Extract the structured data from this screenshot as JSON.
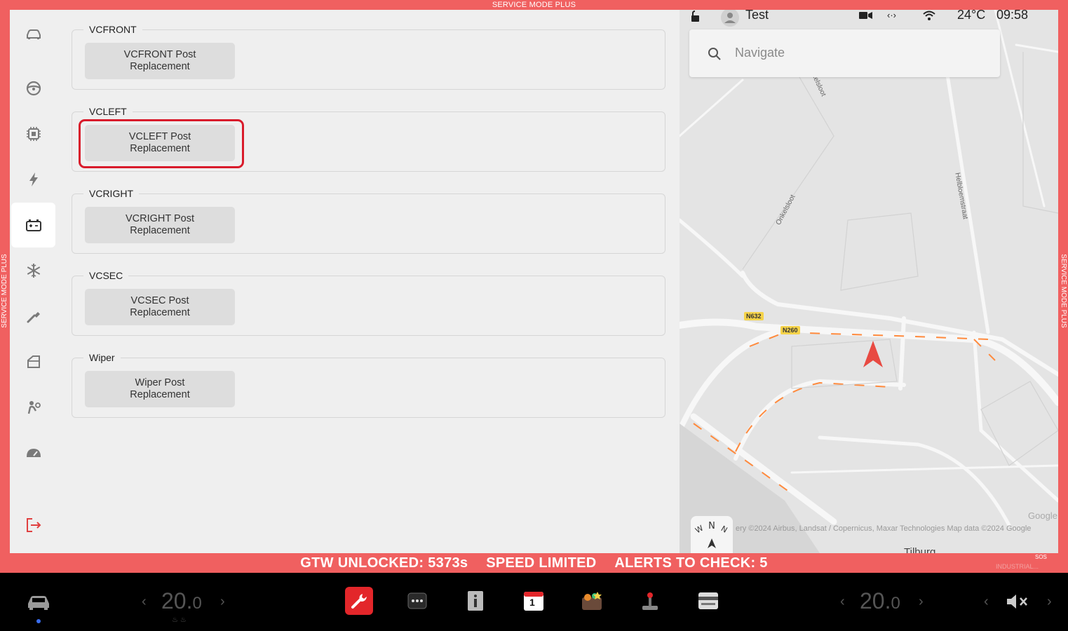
{
  "banner": {
    "top": "SERVICE MODE PLUS",
    "left": "SERVICE MODE PLUS",
    "right": "SERVICE MODE PLUS"
  },
  "sidebar": {
    "items": [
      {
        "icon": "car-icon"
      },
      {
        "icon": "steering-wheel-icon"
      },
      {
        "icon": "chip-icon"
      },
      {
        "icon": "lightning-icon"
      },
      {
        "icon": "battery-icon",
        "active": true
      },
      {
        "icon": "snowflake-icon"
      },
      {
        "icon": "wrench-tool-icon"
      },
      {
        "icon": "door-icon"
      },
      {
        "icon": "airbag-icon"
      },
      {
        "icon": "gauge-icon"
      },
      {
        "icon": "exit-icon"
      }
    ]
  },
  "sections": [
    {
      "label": "VCFRONT",
      "button": "VCFRONT Post\nReplacement"
    },
    {
      "label": "VCLEFT",
      "button": "VCLEFT Post\nReplacement"
    },
    {
      "label": "VCRIGHT",
      "button": "VCRIGHT Post\nReplacement"
    },
    {
      "label": "VCSEC",
      "button": "VCSEC Post\nReplacement"
    },
    {
      "label": "Wiper",
      "button": "Wiper Post\nReplacement"
    }
  ],
  "status": {
    "user": "Test",
    "temperature": "24°C",
    "time": "09:58"
  },
  "map": {
    "search_placeholder": "Navigate",
    "roads": {
      "n632": "N632",
      "n260": "N260",
      "onkelsloot_1": "Onkelsloot",
      "onkelsloot_2": "Onkelsloot",
      "helbloemstraat": "Helbloemstraat"
    },
    "attribution": "ery ©2024 Airbus, Landsat / Copernicus, Maxar Technologies Map data ©2024 Google",
    "google": "Google",
    "city": "Tilburg"
  },
  "alerts": {
    "gtw": "GTW UNLOCKED: 5373s",
    "speed": "SPEED LIMITED",
    "alerts": "ALERTS TO CHECK: 5"
  },
  "corner": {
    "sos": "SOS",
    "industrial": "INDUSTRIAL..."
  },
  "taskbar": {
    "left_temp": "20.0",
    "right_temp": "20.0",
    "apps": [
      "car-icon",
      "service-wrench-icon",
      "more-icon",
      "manual-icon",
      "calendar-icon",
      "toybox-icon",
      "joystick-icon",
      "card-icon"
    ],
    "calendar_day": "1"
  },
  "colors": {
    "banner": "#f06060",
    "highlight": "#d91b2b",
    "active_bg": "#ffffff"
  }
}
